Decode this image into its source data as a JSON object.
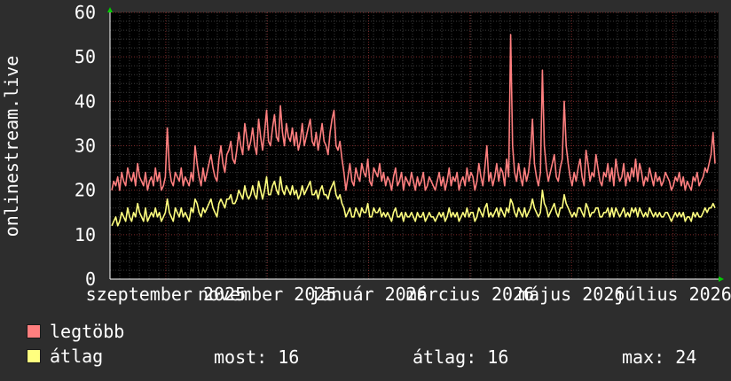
{
  "chart_data": {
    "type": "line",
    "ylabel": "onlinestream.live",
    "ylim": [
      0,
      60
    ],
    "yticks": [
      0,
      10,
      20,
      30,
      40,
      50,
      60
    ],
    "x_tick_labels": [
      "szeptember 2025",
      "november 2025",
      "január 2026",
      "március 2026",
      "május 2026",
      "július 2026"
    ],
    "grid": true,
    "legend_position": "bottom-left",
    "series": [
      {
        "name": "legtöbb",
        "color": "#ff7f7f",
        "values": [
          20,
          22,
          21,
          23,
          20,
          24,
          22,
          21,
          25,
          23,
          22,
          24,
          21,
          26,
          23,
          22,
          21,
          24,
          20,
          22,
          23,
          21,
          25,
          22,
          24,
          20,
          21,
          23,
          34,
          25,
          22,
          21,
          24,
          23,
          22,
          25,
          21,
          23,
          22,
          21,
          24,
          22,
          30,
          26,
          23,
          21,
          25,
          22,
          24,
          26,
          28,
          25,
          23,
          22,
          27,
          30,
          26,
          24,
          28,
          29,
          31,
          27,
          26,
          29,
          33,
          30,
          28,
          35,
          32,
          29,
          31,
          34,
          30,
          28,
          36,
          32,
          29,
          33,
          38,
          31,
          30,
          34,
          37,
          32,
          31,
          39,
          33,
          30,
          35,
          32,
          31,
          34,
          30,
          33,
          29,
          31,
          35,
          30,
          32,
          34,
          36,
          31,
          30,
          33,
          29,
          32,
          35,
          31,
          30,
          28,
          33,
          36,
          38,
          30,
          29,
          31,
          27,
          24,
          20,
          23,
          26,
          22,
          21,
          25,
          23,
          22,
          26,
          24,
          23,
          27,
          22,
          21,
          25,
          24,
          23,
          26,
          22,
          24,
          21,
          23,
          22,
          20,
          23,
          25,
          21,
          22,
          24,
          20,
          23,
          22,
          21,
          24,
          22,
          20,
          23,
          21,
          22,
          24,
          20,
          21,
          23,
          22,
          21,
          20,
          22,
          24,
          21,
          23,
          20,
          22,
          25,
          21,
          23,
          22,
          24,
          20,
          22,
          23,
          21,
          25,
          22,
          24,
          23,
          20,
          22,
          26,
          23,
          21,
          25,
          30,
          22,
          24,
          21,
          23,
          26,
          22,
          25,
          24,
          21,
          27,
          23,
          55,
          30,
          24,
          22,
          26,
          23,
          21,
          25,
          22,
          24,
          28,
          36,
          26,
          23,
          21,
          24,
          47,
          30,
          25,
          22,
          24,
          26,
          28,
          23,
          22,
          25,
          27,
          40,
          30,
          26,
          23,
          21,
          24,
          22,
          25,
          27,
          23,
          21,
          29,
          26,
          22,
          24,
          23,
          28,
          25,
          22,
          21,
          24,
          23,
          26,
          22,
          25,
          21,
          27,
          24,
          22,
          23,
          26,
          21,
          24,
          22,
          25,
          23,
          27,
          22,
          26,
          24,
          21,
          23,
          22,
          25,
          23,
          21,
          24,
          22,
          23,
          21,
          22,
          24,
          23,
          22,
          20,
          21,
          23,
          22,
          24,
          21,
          23,
          20,
          22,
          21,
          20,
          23,
          22,
          24,
          21,
          22,
          23,
          25,
          24,
          26,
          28,
          33,
          26
        ]
      },
      {
        "name": "átlag",
        "color": "#ffff7f",
        "values": [
          12,
          13,
          14,
          12,
          13,
          15,
          14,
          13,
          16,
          14,
          13,
          15,
          14,
          17,
          15,
          14,
          13,
          16,
          13,
          14,
          15,
          14,
          16,
          14,
          15,
          13,
          14,
          15,
          18,
          15,
          14,
          13,
          16,
          15,
          14,
          16,
          14,
          15,
          14,
          13,
          16,
          15,
          18,
          17,
          15,
          14,
          16,
          15,
          16,
          17,
          18,
          16,
          15,
          14,
          17,
          18,
          17,
          16,
          18,
          18,
          19,
          17,
          17,
          18,
          20,
          19,
          18,
          21,
          19,
          18,
          19,
          21,
          19,
          18,
          22,
          20,
          18,
          20,
          23,
          19,
          19,
          21,
          22,
          20,
          19,
          23,
          20,
          19,
          21,
          20,
          19,
          21,
          19,
          20,
          18,
          19,
          21,
          19,
          20,
          21,
          22,
          19,
          19,
          20,
          18,
          20,
          21,
          19,
          19,
          18,
          20,
          21,
          22,
          19,
          18,
          19,
          17,
          16,
          14,
          15,
          16,
          14,
          14,
          16,
          15,
          14,
          16,
          15,
          15,
          17,
          14,
          14,
          16,
          15,
          15,
          16,
          14,
          15,
          14,
          15,
          14,
          13,
          15,
          16,
          14,
          14,
          15,
          13,
          15,
          14,
          14,
          15,
          14,
          13,
          15,
          14,
          14,
          15,
          13,
          14,
          15,
          14,
          14,
          13,
          14,
          15,
          14,
          15,
          13,
          14,
          16,
          14,
          15,
          14,
          15,
          13,
          14,
          15,
          14,
          16,
          14,
          15,
          15,
          13,
          14,
          16,
          15,
          14,
          16,
          17,
          14,
          15,
          14,
          15,
          16,
          14,
          16,
          15,
          14,
          16,
          15,
          18,
          17,
          15,
          14,
          16,
          15,
          14,
          16,
          14,
          15,
          16,
          18,
          16,
          15,
          14,
          15,
          20,
          17,
          16,
          14,
          15,
          16,
          17,
          15,
          14,
          16,
          16,
          19,
          17,
          16,
          15,
          14,
          15,
          14,
          16,
          16,
          15,
          14,
          17,
          16,
          14,
          15,
          15,
          16,
          16,
          14,
          14,
          15,
          15,
          16,
          14,
          16,
          14,
          16,
          15,
          14,
          15,
          16,
          14,
          15,
          14,
          16,
          15,
          16,
          14,
          16,
          15,
          14,
          15,
          14,
          16,
          15,
          14,
          15,
          14,
          15,
          14,
          14,
          15,
          15,
          14,
          13,
          14,
          15,
          14,
          15,
          14,
          15,
          13,
          14,
          14,
          13,
          15,
          14,
          15,
          14,
          14,
          15,
          16,
          15,
          16,
          16,
          17,
          16
        ]
      }
    ]
  },
  "legend": [
    {
      "label": "legtöbb",
      "color": "#ff7f7f"
    },
    {
      "label": "átlag",
      "color": "#ffff7f"
    }
  ],
  "stats": {
    "now_label": "most:",
    "now_value": "16",
    "avg_label": "átlag:",
    "avg_value": "16",
    "max_label": "max:",
    "max_value": "24"
  }
}
